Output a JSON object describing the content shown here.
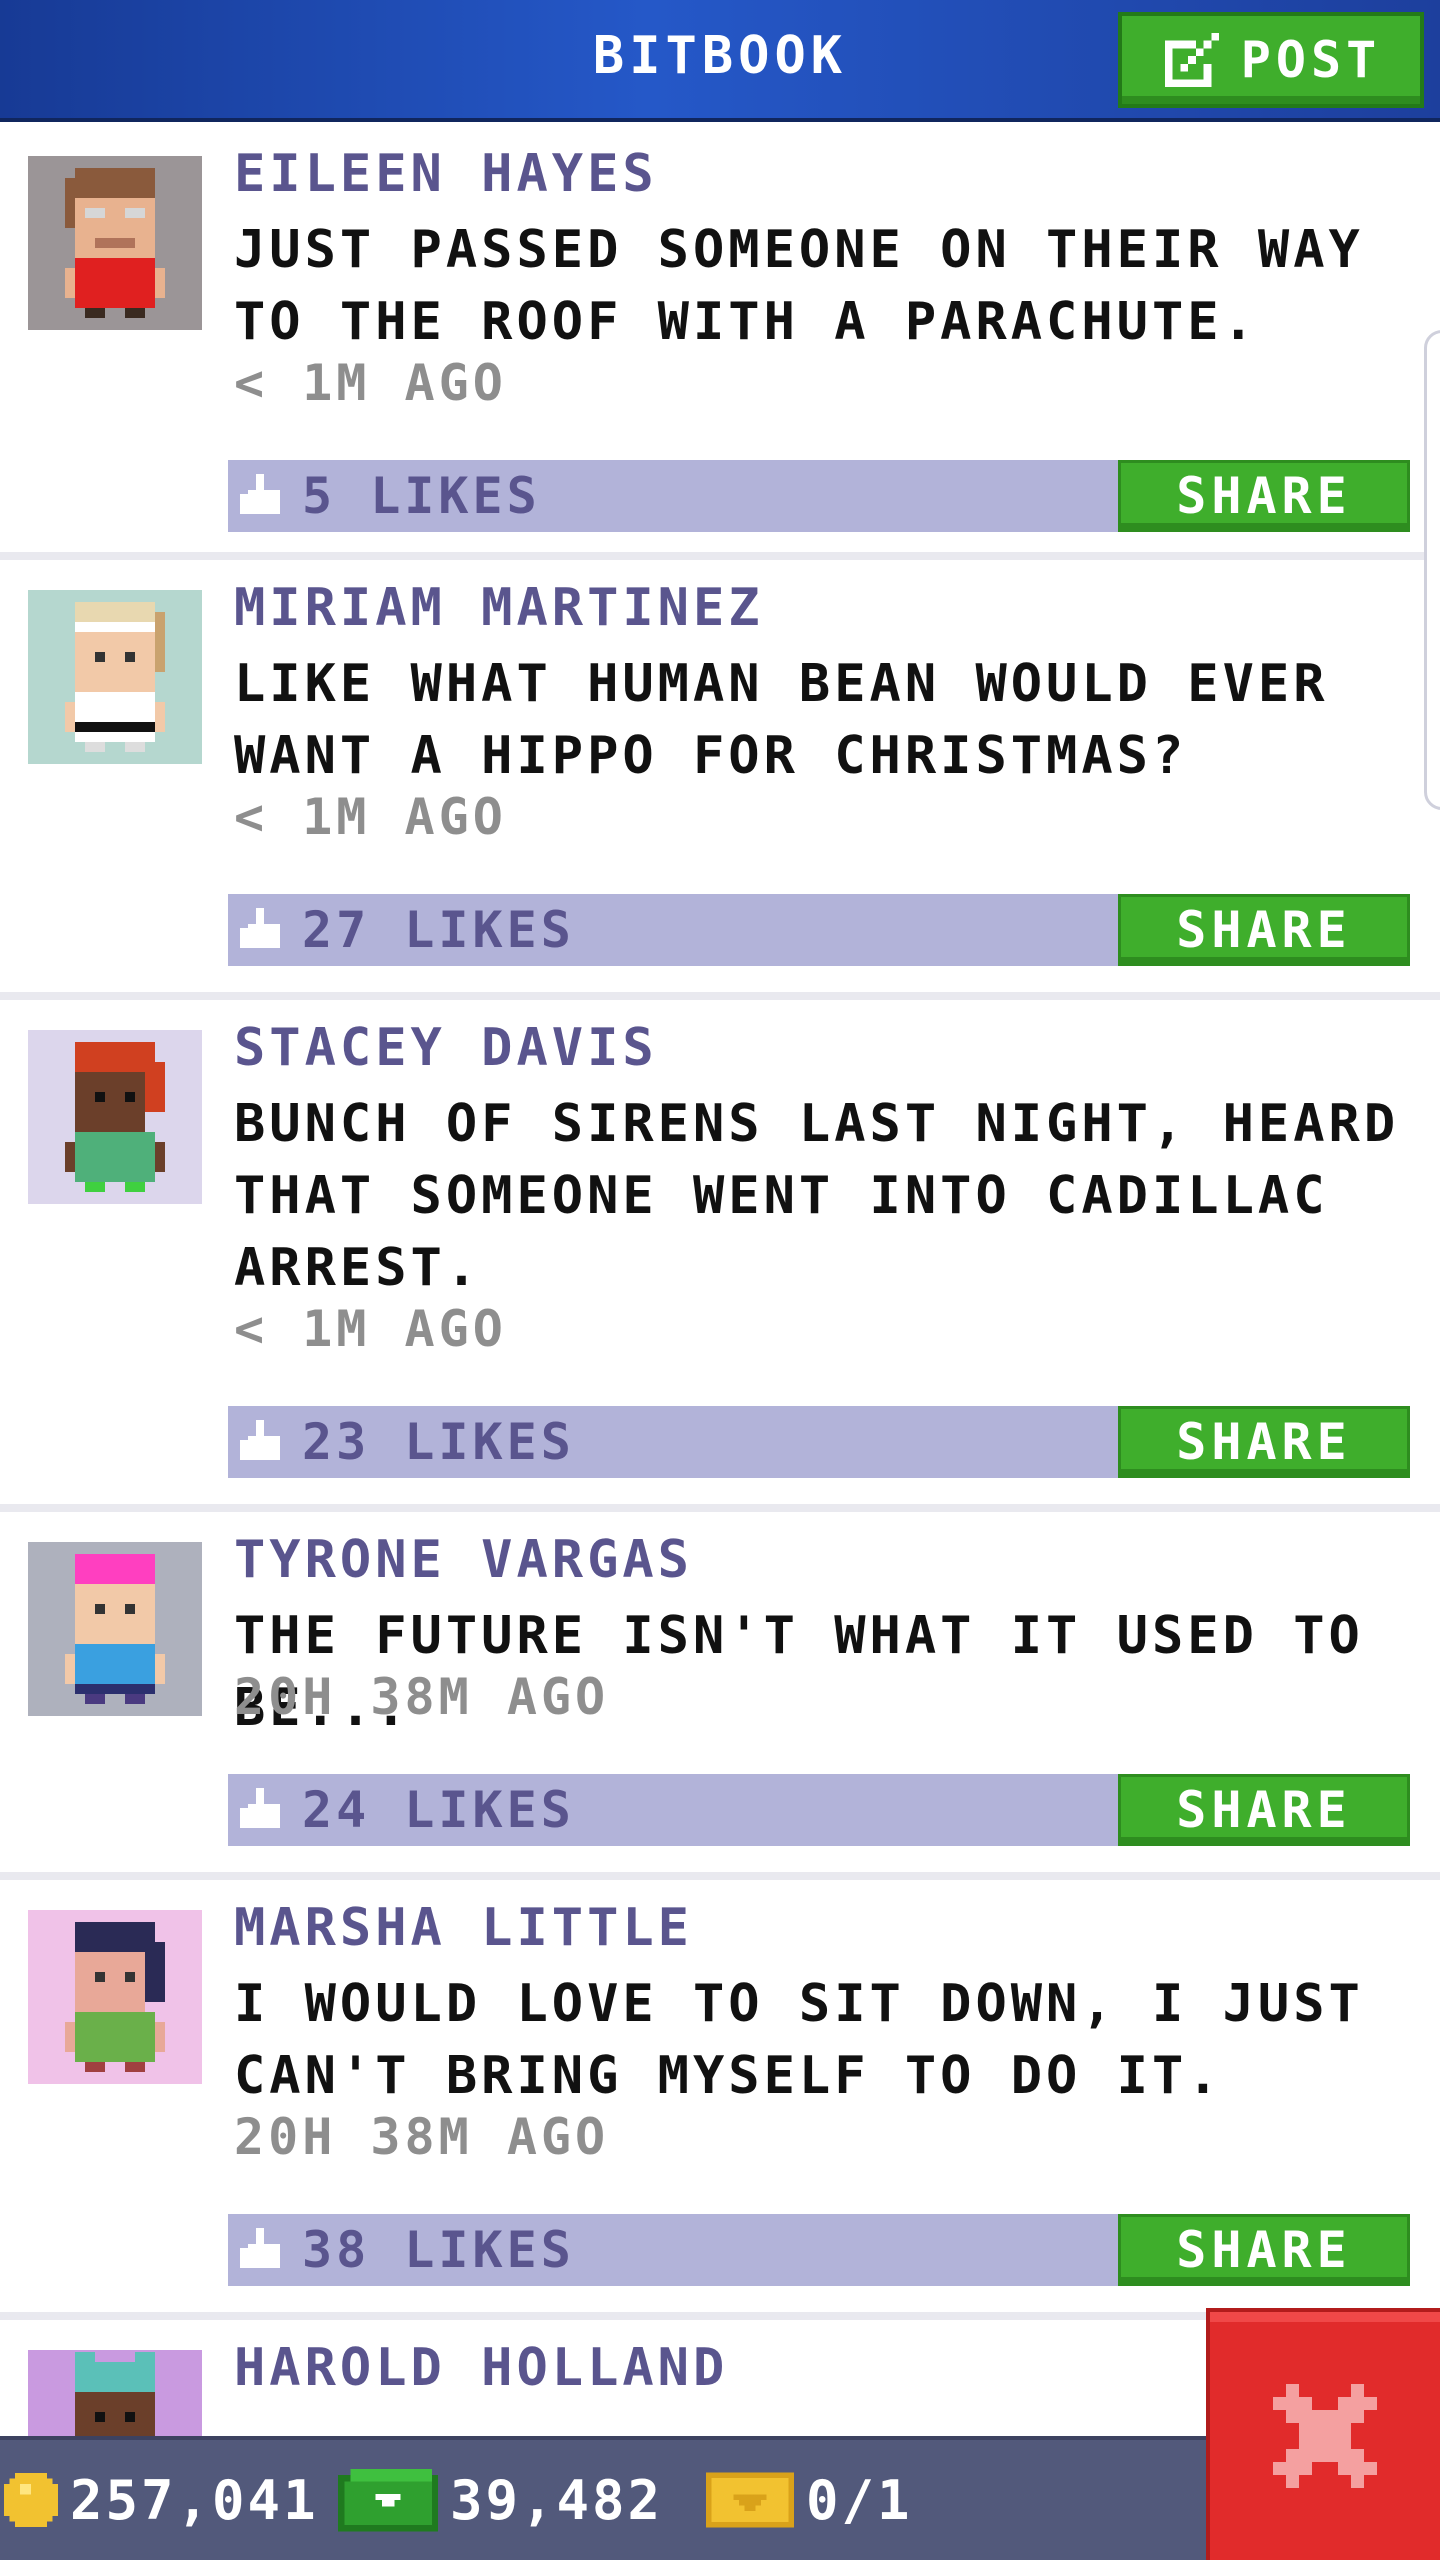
{
  "header": {
    "title": "BITBOOK",
    "post_label": "POST"
  },
  "posts": [
    {
      "author": "EILEEN HAYES",
      "message": "JUST PASSED SOMEONE ON THEIR WAY\nTO THE ROOF WITH A PARACHUTE.",
      "time": "< 1M AGO",
      "likes": "5 LIKES",
      "share": "SHARE",
      "avatar_bg": "#9b9597"
    },
    {
      "author": "MIRIAM MARTINEZ",
      "message": "LIKE WHAT HUMAN BEAN WOULD EVER\nWANT A HIPPO FOR CHRISTMAS?",
      "time": "< 1M AGO",
      "likes": "27 LIKES",
      "share": "SHARE",
      "avatar_bg": "#b5d7cf"
    },
    {
      "author": "STACEY DAVIS",
      "message": "BUNCH OF SIRENS LAST NIGHT, HEARD\nTHAT SOMEONE WENT INTO CADILLAC\nARREST.",
      "time": "< 1M AGO",
      "likes": "23 LIKES",
      "share": "SHARE",
      "avatar_bg": "#dcd6ec"
    },
    {
      "author": "TYRONE VARGAS",
      "message": "THE FUTURE ISN'T WHAT IT USED TO BE...",
      "time": "20H 38M AGO",
      "likes": "24 LIKES",
      "share": "SHARE",
      "avatar_bg": "#aeb1bd"
    },
    {
      "author": "MARSHA LITTLE",
      "message": "I WOULD LOVE TO SIT DOWN, I JUST\nCAN'T BRING MYSELF TO DO IT.",
      "time": "20H 38M AGO",
      "likes": "38 LIKES",
      "share": "SHARE",
      "avatar_bg": "#f0c2e8"
    },
    {
      "author": "HAROLD HOLLAND",
      "avatar_bg": "#c99ae0"
    }
  ],
  "bottom_bar": {
    "coins": "257,041",
    "bux": "39,482",
    "tickets": "0/1"
  },
  "colors": {
    "header_blue": "#2558c8",
    "accent_green": "#3fae2c",
    "likes_bar": "#b2b3d9",
    "author_purple": "#5a558e",
    "close_red": "#e12b2b"
  },
  "icons": {
    "post": "edit-icon",
    "likes": "thumbs-up-icon",
    "coins": "coin-icon",
    "bux": "bux-icon",
    "tickets": "ticket-icon",
    "close": "close-icon"
  }
}
